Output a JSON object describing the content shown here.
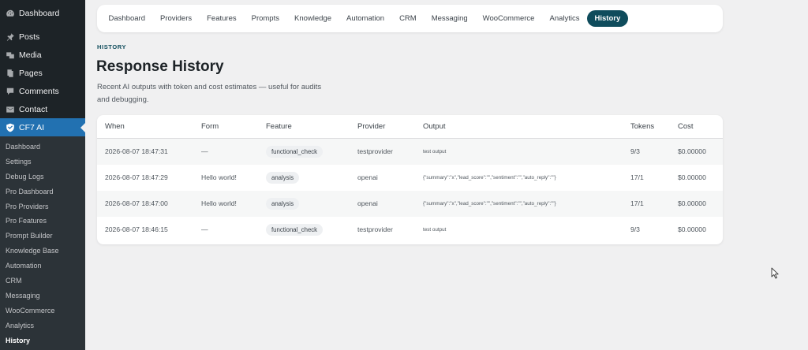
{
  "sidebar": {
    "menu": [
      {
        "label": "Dashboard",
        "icon": "dashboard-icon"
      },
      {
        "label": "Posts",
        "icon": "pin-icon"
      },
      {
        "label": "Media",
        "icon": "media-icon"
      },
      {
        "label": "Pages",
        "icon": "pages-icon"
      },
      {
        "label": "Comments",
        "icon": "comment-icon"
      },
      {
        "label": "Contact",
        "icon": "mail-icon"
      },
      {
        "label": "CF7 AI",
        "icon": "shield-icon"
      }
    ],
    "submenu": [
      "Dashboard",
      "Settings",
      "Debug Logs",
      "Pro Dashboard",
      "Pro Providers",
      "Pro Features",
      "Prompt Builder",
      "Knowledge Base",
      "Automation",
      "CRM",
      "Messaging",
      "WooCommerce",
      "Analytics",
      "History"
    ]
  },
  "tabs": [
    "Dashboard",
    "Providers",
    "Features",
    "Prompts",
    "Knowledge",
    "Automation",
    "CRM",
    "Messaging",
    "WooCommerce",
    "Analytics",
    "History"
  ],
  "page": {
    "eyebrow": "HISTORY",
    "title": "Response History",
    "description": "Recent AI outputs with token and cost estimates — useful for audits and debugging."
  },
  "table": {
    "headers": [
      "When",
      "Form",
      "Feature",
      "Provider",
      "Output",
      "Tokens",
      "Cost"
    ],
    "rows": [
      {
        "when": "2026-08-07 18:47:31",
        "form": "—",
        "feature": "functional_check",
        "provider": "testprovider",
        "output": "test output",
        "tokens": "9/3",
        "cost": "$0.00000"
      },
      {
        "when": "2026-08-07 18:47:29",
        "form": "Hello world!",
        "feature": "analysis",
        "provider": "openai",
        "output": "{\"summary\":\"x\",\"lead_score\":\"\",\"sentiment\":\"\",\"auto_reply\":\"\"}",
        "tokens": "17/1",
        "cost": "$0.00000"
      },
      {
        "when": "2026-08-07 18:47:00",
        "form": "Hello world!",
        "feature": "analysis",
        "provider": "openai",
        "output": "{\"summary\":\"x\",\"lead_score\":\"\",\"sentiment\":\"\",\"auto_reply\":\"\"}",
        "tokens": "17/1",
        "cost": "$0.00000"
      },
      {
        "when": "2026-08-07 18:46:15",
        "form": "—",
        "feature": "functional_check",
        "provider": "testprovider",
        "output": "test output",
        "tokens": "9/3",
        "cost": "$0.00000"
      }
    ]
  },
  "colors": {
    "accent": "#0f4c5c",
    "wp_blue": "#2271b1",
    "sidebar": "#1d2327"
  }
}
